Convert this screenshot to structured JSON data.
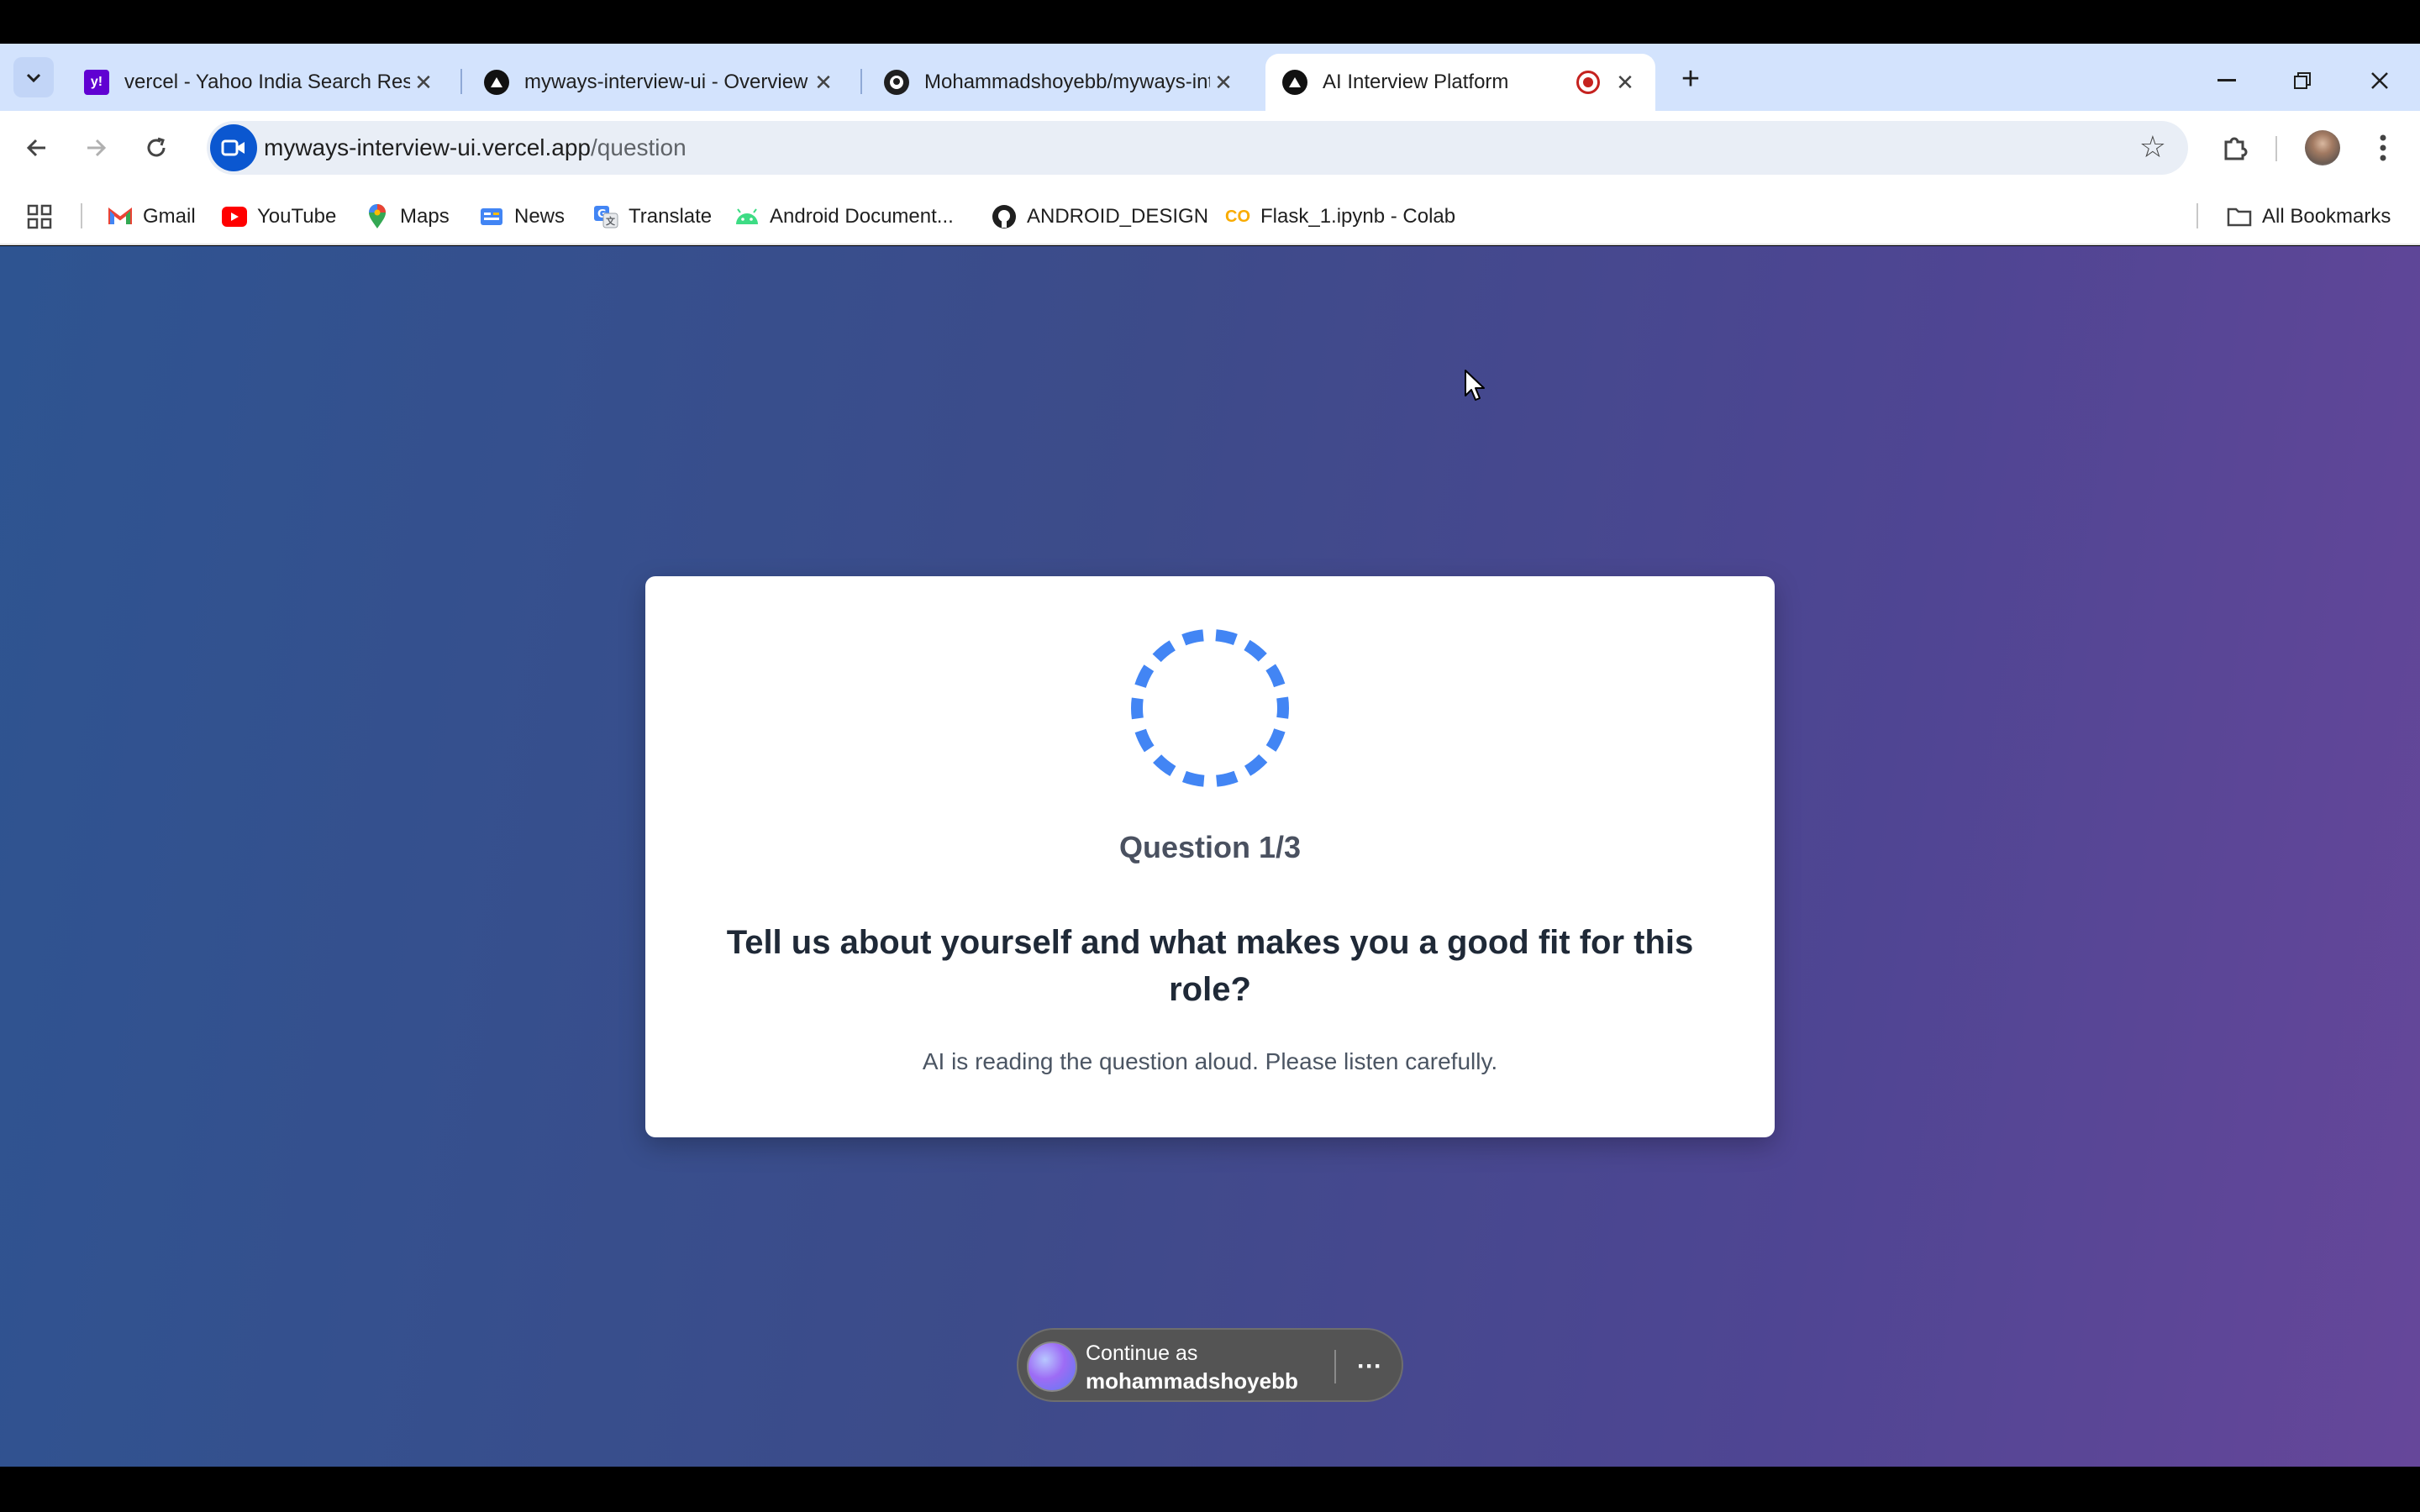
{
  "browser": {
    "tabs": [
      {
        "title": "vercel - Yahoo India Search Results",
        "favicon": "yahoo-icon",
        "active": false
      },
      {
        "title": "myways-interview-ui - Overview",
        "favicon": "vercel-icon",
        "active": false
      },
      {
        "title": "Mohammadshoyebb/myways-interview-ui",
        "favicon": "github-icon",
        "active": false
      },
      {
        "title": "AI Interview Platform",
        "favicon": "vercel-icon",
        "active": true,
        "recording": true
      }
    ],
    "address": {
      "host": "myways-interview-ui.vercel.app",
      "path": "/question"
    },
    "bookmarks": [
      {
        "label": "Gmail",
        "icon": "gmail-icon"
      },
      {
        "label": "YouTube",
        "icon": "youtube-icon"
      },
      {
        "label": "Maps",
        "icon": "maps-icon"
      },
      {
        "label": "News",
        "icon": "news-icon"
      },
      {
        "label": "Translate",
        "icon": "translate-icon"
      },
      {
        "label": "Android Document...",
        "icon": "android-icon"
      },
      {
        "label": "ANDROID_DESIGN",
        "icon": "github-icon"
      },
      {
        "label": "Flask_1.ipynb - Colab",
        "icon": "colab-icon"
      }
    ],
    "all_bookmarks_label": "All Bookmarks"
  },
  "page": {
    "question_counter": "Question 1/3",
    "question_text": "Tell us about yourself and what makes you a good fit for this role?",
    "hint": "AI is reading the question aloud. Please listen carefully.",
    "continue_as": {
      "prefix": "Continue as",
      "username": "mohammadshoyebb",
      "more": "···"
    }
  },
  "colors": {
    "spinner": "#4285f4",
    "gradient_start": "#2e5491",
    "gradient_end": "#66479a",
    "tabstrip": "#d3e3fd"
  }
}
